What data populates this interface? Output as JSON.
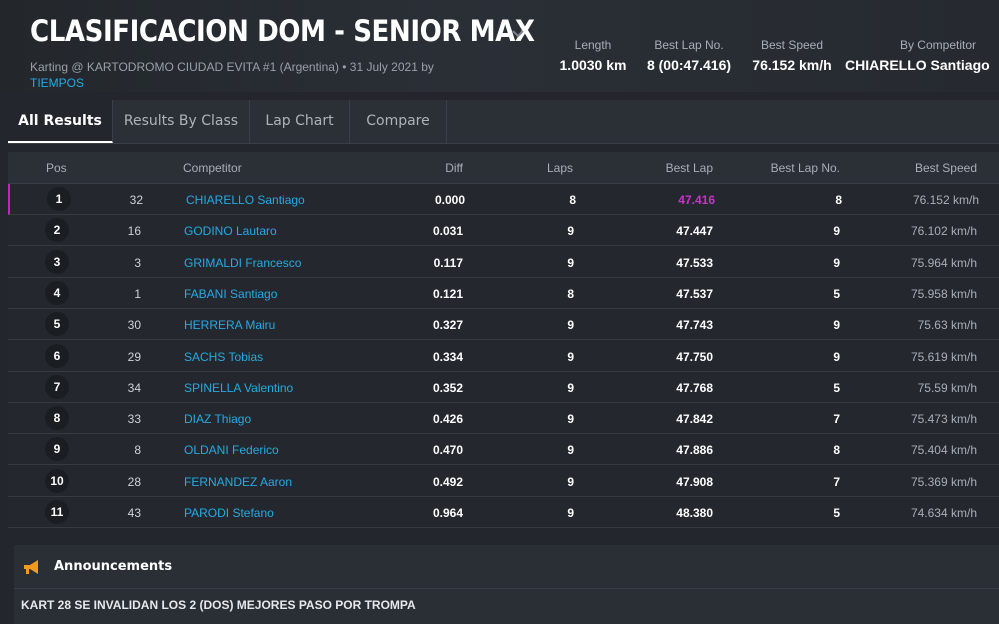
{
  "header": {
    "title": "CLASIFICACION DOM - SENIOR MAX",
    "subtitle_text": "Karting @ KARTODROMO CIUDAD EVITA #1 (Argentina) • 31 July 2021 by",
    "subtitle_link": "TIEMPOS",
    "stats": [
      {
        "label": "Length",
        "value": "1.0030 km"
      },
      {
        "label": "Best Lap No.",
        "value": "8 (00:47.416)"
      },
      {
        "label": "Best Speed",
        "value": "76.152 km/h"
      },
      {
        "label": "By Competitor",
        "value": "CHIARELLO Santiago"
      }
    ]
  },
  "tabs": [
    {
      "label": "All Results",
      "active": true
    },
    {
      "label": "Results By Class",
      "active": false
    },
    {
      "label": "Lap Chart",
      "active": false
    },
    {
      "label": "Compare",
      "active": false
    }
  ],
  "table": {
    "columns": {
      "pos": "Pos",
      "competitor": "Competitor",
      "diff": "Diff",
      "laps": "Laps",
      "best_lap": "Best Lap",
      "best_lap_no": "Best Lap No.",
      "best_speed": "Best Speed"
    },
    "rows": [
      {
        "pos": "1",
        "kart": "32",
        "name": "CHIARELLO Santiago",
        "diff": "0.000",
        "laps": "8",
        "best_lap": "47.416",
        "best_lap_no": "8",
        "best_speed": "76.152 km/h"
      },
      {
        "pos": "2",
        "kart": "16",
        "name": "GODINO Lautaro",
        "diff": "0.031",
        "laps": "9",
        "best_lap": "47.447",
        "best_lap_no": "9",
        "best_speed": "76.102 km/h"
      },
      {
        "pos": "3",
        "kart": "3",
        "name": "GRIMALDI Francesco",
        "diff": "0.117",
        "laps": "9",
        "best_lap": "47.533",
        "best_lap_no": "9",
        "best_speed": "75.964 km/h"
      },
      {
        "pos": "4",
        "kart": "1",
        "name": "FABANI Santiago",
        "diff": "0.121",
        "laps": "8",
        "best_lap": "47.537",
        "best_lap_no": "5",
        "best_speed": "75.958 km/h"
      },
      {
        "pos": "5",
        "kart": "30",
        "name": "HERRERA Mairu",
        "diff": "0.327",
        "laps": "9",
        "best_lap": "47.743",
        "best_lap_no": "9",
        "best_speed": "75.63 km/h"
      },
      {
        "pos": "6",
        "kart": "29",
        "name": "SACHS Tobias",
        "diff": "0.334",
        "laps": "9",
        "best_lap": "47.750",
        "best_lap_no": "9",
        "best_speed": "75.619 km/h"
      },
      {
        "pos": "7",
        "kart": "34",
        "name": "SPINELLA Valentino",
        "diff": "0.352",
        "laps": "9",
        "best_lap": "47.768",
        "best_lap_no": "5",
        "best_speed": "75.59 km/h"
      },
      {
        "pos": "8",
        "kart": "33",
        "name": "DIAZ Thiago",
        "diff": "0.426",
        "laps": "9",
        "best_lap": "47.842",
        "best_lap_no": "7",
        "best_speed": "75.473 km/h"
      },
      {
        "pos": "9",
        "kart": "8",
        "name": "OLDANI Federico",
        "diff": "0.470",
        "laps": "9",
        "best_lap": "47.886",
        "best_lap_no": "8",
        "best_speed": "75.404 km/h"
      },
      {
        "pos": "10",
        "kart": "28",
        "name": "FERNANDEZ Aaron",
        "diff": "0.492",
        "laps": "9",
        "best_lap": "47.908",
        "best_lap_no": "7",
        "best_speed": "75.369 km/h"
      },
      {
        "pos": "11",
        "kart": "43",
        "name": "PARODI Stefano",
        "diff": "0.964",
        "laps": "9",
        "best_lap": "48.380",
        "best_lap_no": "5",
        "best_speed": "74.634 km/h"
      }
    ]
  },
  "announcements": {
    "title": "Announcements",
    "icon": "megaphone-icon",
    "message": "KART 28 SE INVALIDAN LOS 2 (DOS) MEJORES PASO POR TROMPA"
  },
  "colors": {
    "accent_link": "#27a9e1",
    "best_lap_highlight": "#c832c8",
    "announcement_icon": "#f29a1f"
  }
}
